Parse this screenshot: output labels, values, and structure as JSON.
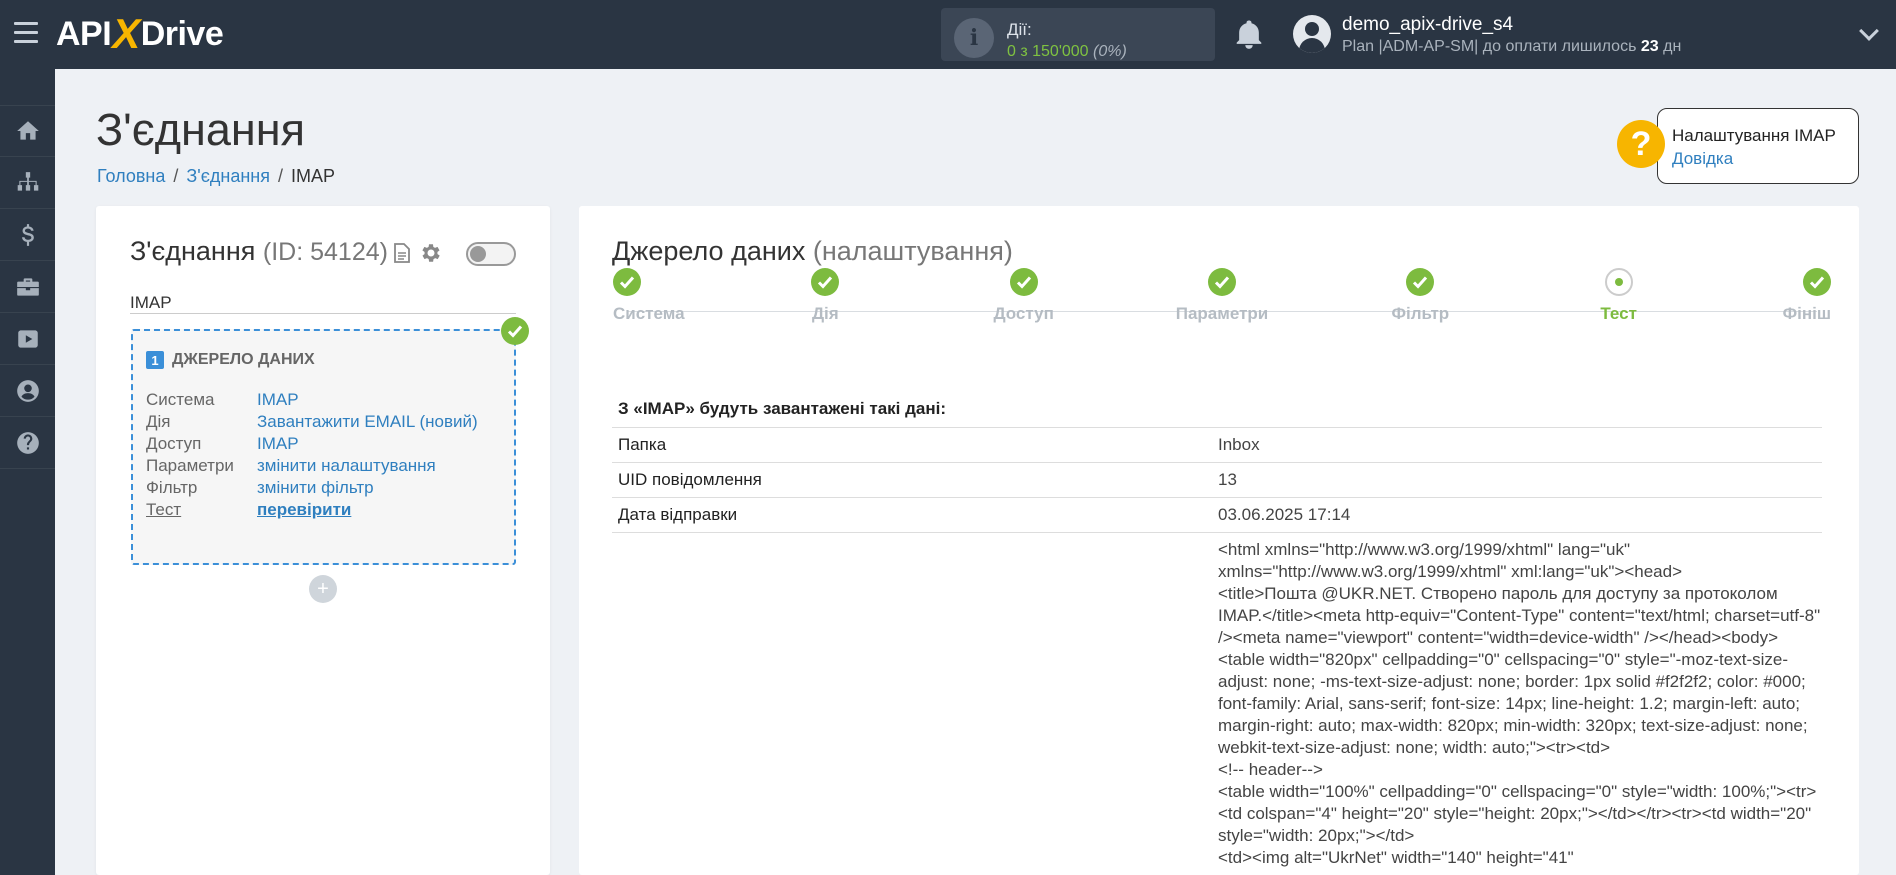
{
  "topbar": {
    "logo_api": "API",
    "logo_x": "X",
    "logo_drive": "Drive",
    "actions_label": "Дії:",
    "actions_value": "0 з 150'000",
    "actions_percent": "(0%)",
    "user_name": "demo_apix-drive_s4",
    "user_plan_prefix": "Plan |ADM-AP-SM| до оплати лишилось ",
    "user_plan_days": "23",
    "user_plan_suffix": " дн"
  },
  "page": {
    "title": "З'єднання",
    "breadcrumb": [
      "Головна",
      "З'єднання",
      "IMAP"
    ]
  },
  "help": {
    "title": "Налаштування IMAP",
    "link": "Довідка"
  },
  "left_panel": {
    "title": "З'єднання",
    "id_text": "(ID: 54124)",
    "connection_name": "IMAP",
    "source_num": "1",
    "source_header": "ДЖЕРЕЛО ДАНИХ",
    "rows": [
      {
        "k": "Система",
        "v": "IMAP"
      },
      {
        "k": "Дія",
        "v": "Завантажити EMAIL (новий)"
      },
      {
        "k": "Доступ",
        "v": "IMAP"
      },
      {
        "k": "Параметри",
        "v": "змінити налаштування"
      },
      {
        "k": "Фільтр",
        "v": "змінити фільтр"
      },
      {
        "k": "Тест",
        "v": "перевірити"
      }
    ],
    "add_symbol": "+"
  },
  "right_panel": {
    "title": "Джерело даних",
    "subtitle": "(налаштування)",
    "steps": [
      "Система",
      "Дія",
      "Доступ",
      "Параметри",
      "Фільтр",
      "Тест",
      "Фініш"
    ],
    "current_step": 5,
    "data_title": "З «IMAP» будуть завантажені такі дані:",
    "rows": [
      {
        "k": "Папка",
        "v": "Inbox"
      },
      {
        "k": "UID повідомлення",
        "v": "13"
      },
      {
        "k": "Дата відправки",
        "v": "03.06.2025 17:14"
      },
      {
        "k": "",
        "v": "<html xmlns=\"http://www.w3.org/1999/xhtml\" lang=\"uk\" xmlns=\"http://www.w3.org/1999/xhtml\" xml:lang=\"uk\"><head>\n<title>Пошта @UKR.NET. Створено пароль для доступу за протоколом IMAP.</title><meta http-equiv=\"Content-Type\" content=\"text/html; charset=utf-8\" /><meta name=\"viewport\" content=\"width=device-width\" /></head><body>\n<table width=\"820px\" cellpadding=\"0\" cellspacing=\"0\" style=\"-moz-text-size-adjust: none; -ms-text-size-adjust: none; border: 1px solid #f2f2f2; color: #000; font-family: Arial, sans-serif; font-size: 14px; line-height: 1.2; margin-left: auto; margin-right: auto; max-width: 820px; min-width: 320px; text-size-adjust: none; webkit-text-size-adjust: none; width: auto;\"><tr><td>\n<!-- header-->\n<table width=\"100%\" cellpadding=\"0\" cellspacing=\"0\" style=\"width: 100%;\"><tr><td colspan=\"4\" height=\"20\" style=\"height: 20px;\"></td></tr><tr><td width=\"20\" style=\"width: 20px;\"></td>\n<td><img alt=\"UkrNet\" width=\"140\" height=\"41\""
      }
    ]
  }
}
